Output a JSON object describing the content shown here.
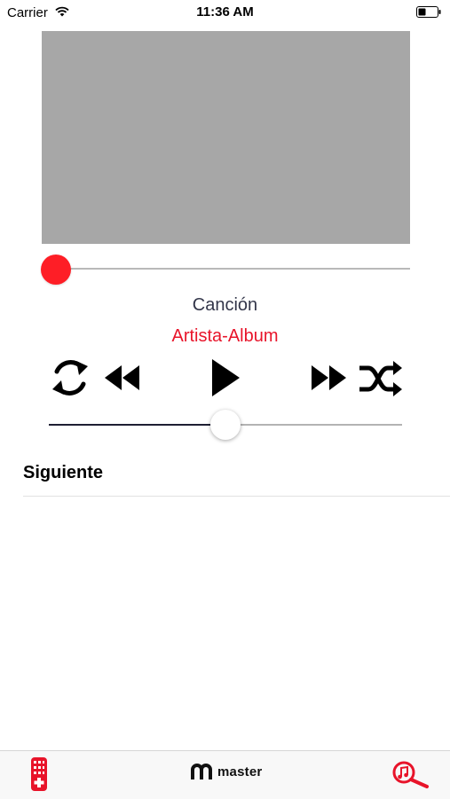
{
  "status_bar": {
    "carrier": "Carrier",
    "time": "11:36 AM",
    "icons": [
      "wifi-icon",
      "battery-icon"
    ]
  },
  "player": {
    "artwork_color": "#a7a7a7",
    "progress": 0.0,
    "progress_knob_color": "#fe1e26",
    "song_title": "Canción",
    "artist_album": "Artista-Album",
    "controls": [
      "repeat-icon",
      "rewind-icon",
      "play-icon",
      "fast-forward-icon",
      "shuffle-icon"
    ],
    "volume": 0.5
  },
  "queue": {
    "header": "Siguiente"
  },
  "tab_bar": {
    "left_icon": "remote-control-icon",
    "logo_text": "master",
    "right_icon": "music-search-icon",
    "accent_color": "#e8142a"
  }
}
